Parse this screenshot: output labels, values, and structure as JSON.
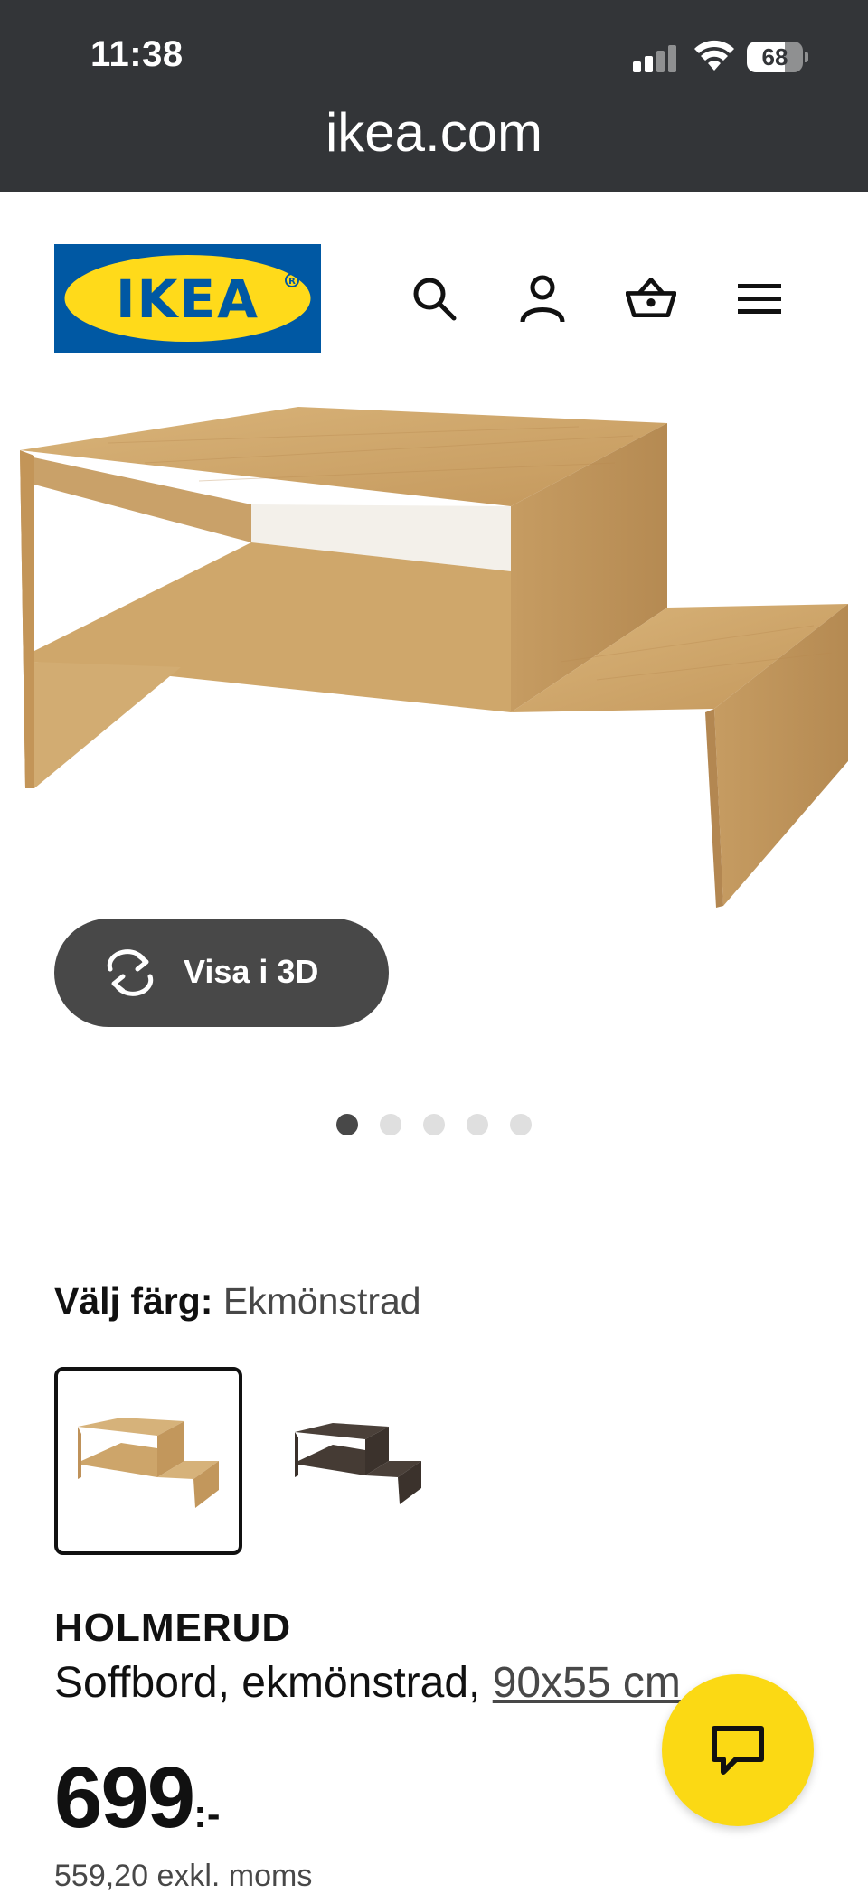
{
  "status_bar": {
    "time": "11:38",
    "battery": "68",
    "battery_level": 0.68
  },
  "browser": {
    "url": "ikea.com"
  },
  "header": {
    "logo_text": "IKEA",
    "icons": [
      "search-icon",
      "account-icon",
      "shopping-basket-icon",
      "menu-icon"
    ]
  },
  "gallery": {
    "view_3d_label": "Visa i 3D",
    "dots_count": 5,
    "active_dot": 0
  },
  "color_picker": {
    "label": "Välj färg:",
    "selected_value": "Ekmönstrad",
    "options": [
      "oak-effect",
      "black-brown"
    ]
  },
  "product": {
    "name": "HOLMERUD",
    "description": "Soffbord, ekmönstrad, ",
    "size": "90x55 cm",
    "price": "699",
    "price_suffix": ":-",
    "price_excl_vat": "559,20 exkl. moms"
  },
  "colors": {
    "status_bar_bg": "#333538",
    "ikea_blue": "#0058a3",
    "ikea_yellow": "#ffda1a",
    "button_dark": "#484848",
    "chat_yellow": "#fbd914"
  }
}
